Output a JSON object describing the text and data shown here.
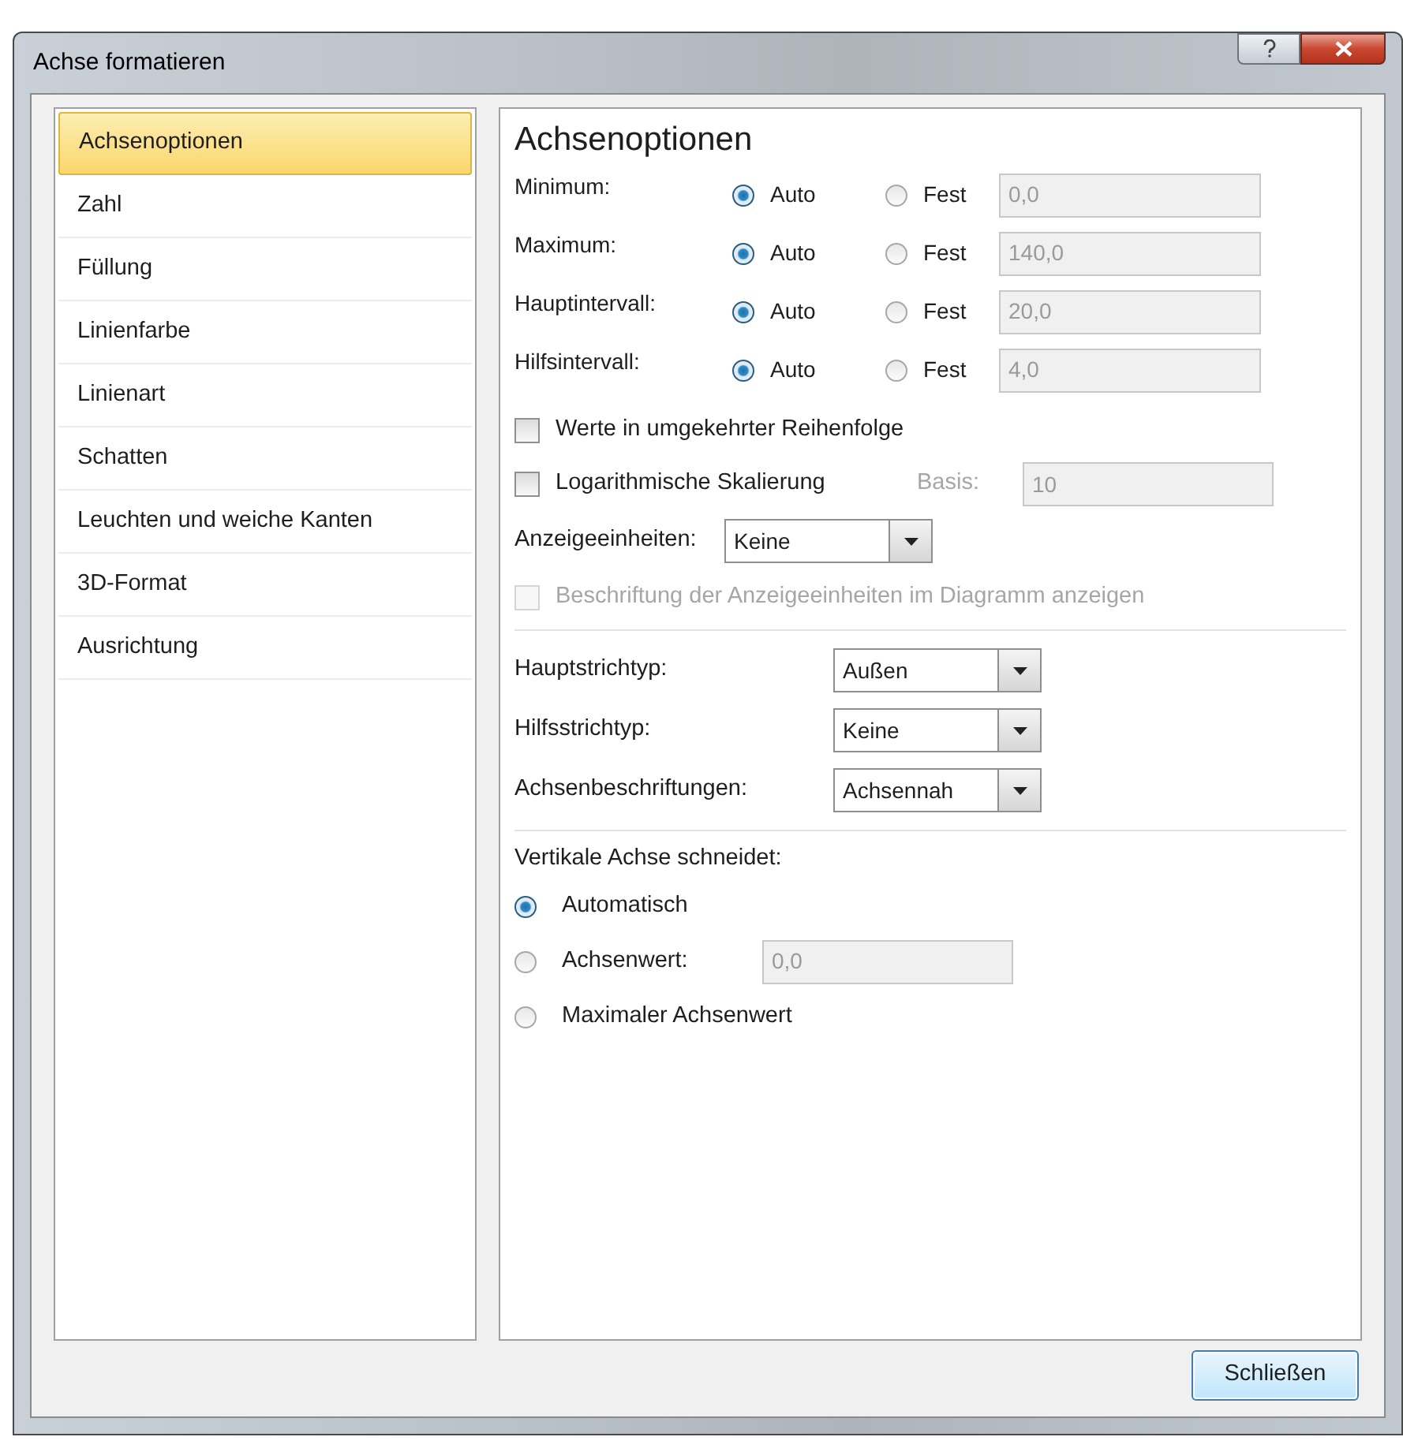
{
  "window": {
    "title": "Achse formatieren"
  },
  "sidebar": {
    "items": [
      {
        "label": "Achsenoptionen",
        "selected": true
      },
      {
        "label": "Zahl",
        "selected": false
      },
      {
        "label": "Füllung",
        "selected": false
      },
      {
        "label": "Linienfarbe",
        "selected": false
      },
      {
        "label": "Linienart",
        "selected": false
      },
      {
        "label": "Schatten",
        "selected": false
      },
      {
        "label": "Leuchten und weiche Kanten",
        "selected": false
      },
      {
        "label": "3D-Format",
        "selected": false
      },
      {
        "label": "Ausrichtung",
        "selected": false
      }
    ]
  },
  "panel": {
    "heading": "Achsenoptionen",
    "bounds": [
      {
        "label": "Minimum:",
        "options": [
          {
            "label": "Auto",
            "selected": true
          },
          {
            "label": "Fest",
            "selected": false
          }
        ],
        "value": "0,0",
        "disabled": true
      },
      {
        "label": "Maximum:",
        "options": [
          {
            "label": "Auto",
            "selected": true
          },
          {
            "label": "Fest",
            "selected": false
          }
        ],
        "value": "140,0",
        "disabled": true
      },
      {
        "label": "Hauptintervall:",
        "options": [
          {
            "label": "Auto",
            "selected": true
          },
          {
            "label": "Fest",
            "selected": false
          }
        ],
        "value": "20,0",
        "disabled": true
      },
      {
        "label": "Hilfsintervall:",
        "options": [
          {
            "label": "Auto",
            "selected": true
          },
          {
            "label": "Fest",
            "selected": false
          }
        ],
        "value": "4,0",
        "disabled": true
      }
    ],
    "reverse": {
      "label": "Werte in umgekehrter Reihenfolge",
      "checked": false,
      "disabled": false
    },
    "log": {
      "label": "Logarithmische Skalierung",
      "checked": false,
      "disabled": false,
      "base_label": "Basis:",
      "base_value": "10",
      "base_disabled": true
    },
    "display_units": {
      "label": "Anzeigeeinheiten:",
      "value": "Keine"
    },
    "show_units_label": {
      "label": "Beschriftung der Anzeigeeinheiten im Diagramm anzeigen",
      "checked": false,
      "disabled": true
    },
    "ticks": [
      {
        "label": "Hauptstrichtyp:",
        "value": "Außen"
      },
      {
        "label": "Hilfsstrichtyp:",
        "value": "Keine"
      },
      {
        "label": "Achsenbeschriftungen:",
        "value": "Achsennah"
      }
    ],
    "crosses": {
      "label": "Vertikale Achse schneidet:",
      "options": [
        {
          "label": "Automatisch",
          "selected": true
        },
        {
          "label": "Achsenwert:",
          "selected": false,
          "value": "0,0",
          "disabled": true
        },
        {
          "label": "Maximaler Achsenwert",
          "selected": false
        }
      ]
    }
  },
  "close_button": "Schließen"
}
